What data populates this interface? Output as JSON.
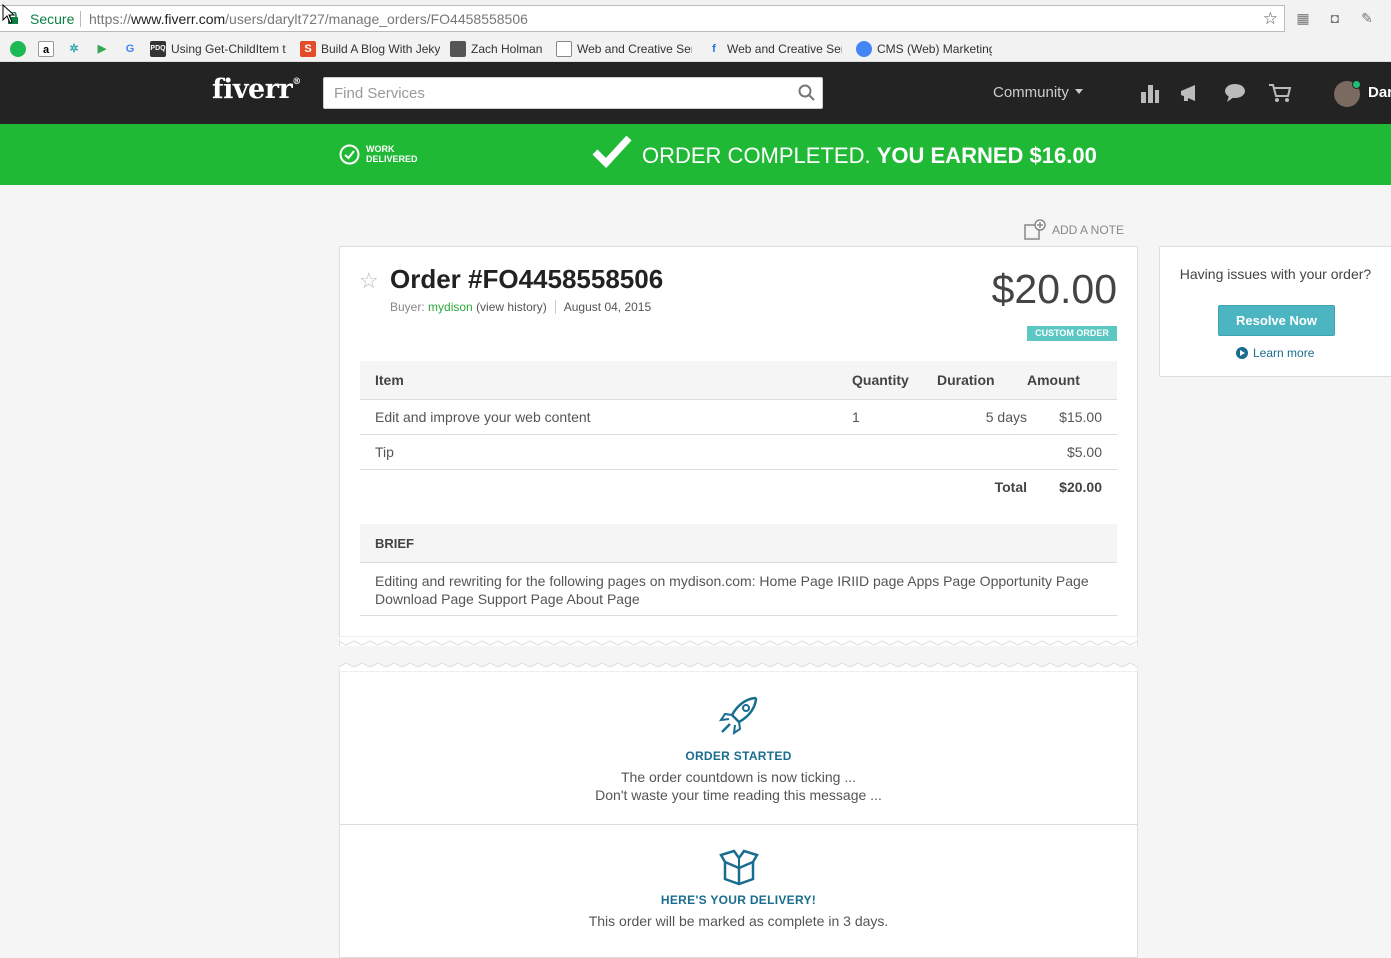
{
  "browser": {
    "secure_label": "Secure",
    "url_scheme": "https://",
    "url_host": "www.fiverr.com",
    "url_path": "/users/darylt727/manage_orders/FO4458558506",
    "bookmarks": [
      {
        "icon": "spotify-icon",
        "label": ""
      },
      {
        "icon": "amazon-icon",
        "label": ""
      },
      {
        "icon": "snowflake-icon",
        "label": ""
      },
      {
        "icon": "play-store-icon",
        "label": ""
      },
      {
        "icon": "google-icon",
        "label": ""
      },
      {
        "icon": "pdq-icon",
        "label": "Using Get-ChildItem t"
      },
      {
        "icon": "s-icon",
        "label": "Build A Blog With Jeky"
      },
      {
        "icon": "person-icon",
        "label": "Zach Holman"
      },
      {
        "icon": "page-icon",
        "label": "Web and Creative Ser"
      },
      {
        "icon": "f-icon",
        "label": "Web and Creative Ser"
      },
      {
        "icon": "chrome-icon",
        "label": "CMS (Web) Marketing"
      }
    ]
  },
  "header": {
    "logo": "fiverr",
    "search_placeholder": "Find Services",
    "community_label": "Community",
    "username": "Dar"
  },
  "banner": {
    "status_line1": "WORK",
    "status_line2": "DELIVERED",
    "message": "ORDER COMPLETED.",
    "earned": "YOU EARNED $16.00",
    "colors": {
      "banner": "#1fb935",
      "link": "#1a6d8e",
      "badge": "#5bc8c4",
      "button": "#4cb5c2"
    }
  },
  "order": {
    "add_note": "ADD A NOTE",
    "title": "Order #FO4458558506",
    "buyer_prefix": "Buyer:",
    "buyer_name": "mydison",
    "history_link": "(view history)",
    "date": "August 04, 2015",
    "price": "$20.00",
    "badge": "CUSTOM ORDER",
    "columns": [
      "Item",
      "Quantity",
      "Duration",
      "Amount"
    ],
    "rows": [
      {
        "item": "Edit and improve your web content",
        "quantity": "1",
        "duration": "5 days",
        "amount": "$15.00"
      },
      {
        "item": "Tip",
        "quantity": "",
        "duration": "",
        "amount": "$5.00"
      }
    ],
    "total_label": "Total",
    "total_value": "$20.00",
    "brief_heading": "BRIEF",
    "brief_text": "Editing and rewriting for the following pages on mydison.com: Home Page IRIID page Apps Page Opportunity Page Download Page Support Page About Page"
  },
  "timeline": {
    "started_heading": "ORDER STARTED",
    "started_line1": "The order countdown is now ticking ...",
    "started_line2": "Don't waste your time reading this message ...",
    "delivery_heading": "HERE'S YOUR DELIVERY!",
    "delivery_text": "This order will be marked as complete in 3 days."
  },
  "sidebar": {
    "question": "Having issues with your order?",
    "resolve_label": "Resolve Now",
    "learn_label": "Learn more"
  }
}
